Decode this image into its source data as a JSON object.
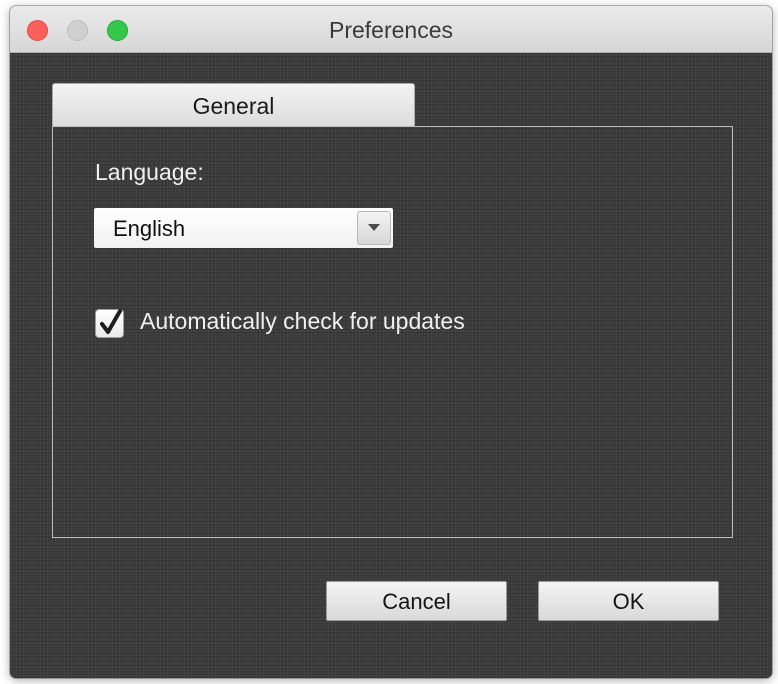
{
  "window": {
    "title": "Preferences",
    "traffic_lights": {
      "close_color": "#fc605c",
      "minimize_color": "#d0d0d0",
      "zoom_color": "#34c84a"
    }
  },
  "tabs": [
    {
      "label": "General",
      "selected": true
    }
  ],
  "general": {
    "language_label": "Language:",
    "language_select": {
      "value": "English",
      "icon": "chevron-down-icon"
    },
    "auto_update": {
      "label": "Automatically check for updates",
      "checked": true,
      "icon": "checkmark-icon"
    }
  },
  "footer": {
    "cancel_label": "Cancel",
    "ok_label": "OK"
  },
  "colors": {
    "background": "#3e3e3e",
    "text": "#f0f0f0"
  }
}
